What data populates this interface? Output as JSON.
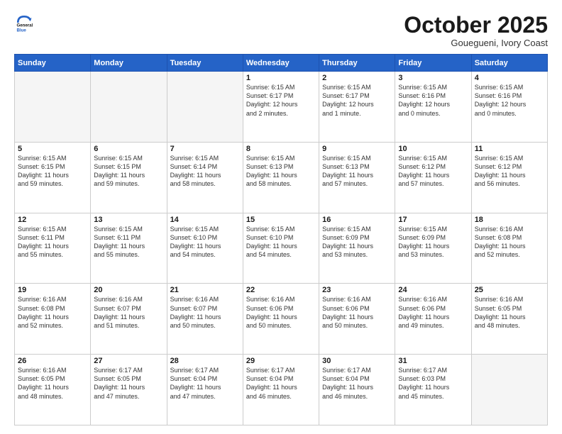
{
  "header": {
    "logo_line1": "General",
    "logo_line2": "Blue",
    "month": "October 2025",
    "location": "Gouegueni, Ivory Coast"
  },
  "weekdays": [
    "Sunday",
    "Monday",
    "Tuesday",
    "Wednesday",
    "Thursday",
    "Friday",
    "Saturday"
  ],
  "weeks": [
    [
      {
        "day": "",
        "info": ""
      },
      {
        "day": "",
        "info": ""
      },
      {
        "day": "",
        "info": ""
      },
      {
        "day": "1",
        "info": "Sunrise: 6:15 AM\nSunset: 6:17 PM\nDaylight: 12 hours\nand 2 minutes."
      },
      {
        "day": "2",
        "info": "Sunrise: 6:15 AM\nSunset: 6:17 PM\nDaylight: 12 hours\nand 1 minute."
      },
      {
        "day": "3",
        "info": "Sunrise: 6:15 AM\nSunset: 6:16 PM\nDaylight: 12 hours\nand 0 minutes."
      },
      {
        "day": "4",
        "info": "Sunrise: 6:15 AM\nSunset: 6:16 PM\nDaylight: 12 hours\nand 0 minutes."
      }
    ],
    [
      {
        "day": "5",
        "info": "Sunrise: 6:15 AM\nSunset: 6:15 PM\nDaylight: 11 hours\nand 59 minutes."
      },
      {
        "day": "6",
        "info": "Sunrise: 6:15 AM\nSunset: 6:15 PM\nDaylight: 11 hours\nand 59 minutes."
      },
      {
        "day": "7",
        "info": "Sunrise: 6:15 AM\nSunset: 6:14 PM\nDaylight: 11 hours\nand 58 minutes."
      },
      {
        "day": "8",
        "info": "Sunrise: 6:15 AM\nSunset: 6:13 PM\nDaylight: 11 hours\nand 58 minutes."
      },
      {
        "day": "9",
        "info": "Sunrise: 6:15 AM\nSunset: 6:13 PM\nDaylight: 11 hours\nand 57 minutes."
      },
      {
        "day": "10",
        "info": "Sunrise: 6:15 AM\nSunset: 6:12 PM\nDaylight: 11 hours\nand 57 minutes."
      },
      {
        "day": "11",
        "info": "Sunrise: 6:15 AM\nSunset: 6:12 PM\nDaylight: 11 hours\nand 56 minutes."
      }
    ],
    [
      {
        "day": "12",
        "info": "Sunrise: 6:15 AM\nSunset: 6:11 PM\nDaylight: 11 hours\nand 55 minutes."
      },
      {
        "day": "13",
        "info": "Sunrise: 6:15 AM\nSunset: 6:11 PM\nDaylight: 11 hours\nand 55 minutes."
      },
      {
        "day": "14",
        "info": "Sunrise: 6:15 AM\nSunset: 6:10 PM\nDaylight: 11 hours\nand 54 minutes."
      },
      {
        "day": "15",
        "info": "Sunrise: 6:15 AM\nSunset: 6:10 PM\nDaylight: 11 hours\nand 54 minutes."
      },
      {
        "day": "16",
        "info": "Sunrise: 6:15 AM\nSunset: 6:09 PM\nDaylight: 11 hours\nand 53 minutes."
      },
      {
        "day": "17",
        "info": "Sunrise: 6:15 AM\nSunset: 6:09 PM\nDaylight: 11 hours\nand 53 minutes."
      },
      {
        "day": "18",
        "info": "Sunrise: 6:16 AM\nSunset: 6:08 PM\nDaylight: 11 hours\nand 52 minutes."
      }
    ],
    [
      {
        "day": "19",
        "info": "Sunrise: 6:16 AM\nSunset: 6:08 PM\nDaylight: 11 hours\nand 52 minutes."
      },
      {
        "day": "20",
        "info": "Sunrise: 6:16 AM\nSunset: 6:07 PM\nDaylight: 11 hours\nand 51 minutes."
      },
      {
        "day": "21",
        "info": "Sunrise: 6:16 AM\nSunset: 6:07 PM\nDaylight: 11 hours\nand 50 minutes."
      },
      {
        "day": "22",
        "info": "Sunrise: 6:16 AM\nSunset: 6:06 PM\nDaylight: 11 hours\nand 50 minutes."
      },
      {
        "day": "23",
        "info": "Sunrise: 6:16 AM\nSunset: 6:06 PM\nDaylight: 11 hours\nand 50 minutes."
      },
      {
        "day": "24",
        "info": "Sunrise: 6:16 AM\nSunset: 6:06 PM\nDaylight: 11 hours\nand 49 minutes."
      },
      {
        "day": "25",
        "info": "Sunrise: 6:16 AM\nSunset: 6:05 PM\nDaylight: 11 hours\nand 48 minutes."
      }
    ],
    [
      {
        "day": "26",
        "info": "Sunrise: 6:16 AM\nSunset: 6:05 PM\nDaylight: 11 hours\nand 48 minutes."
      },
      {
        "day": "27",
        "info": "Sunrise: 6:17 AM\nSunset: 6:05 PM\nDaylight: 11 hours\nand 47 minutes."
      },
      {
        "day": "28",
        "info": "Sunrise: 6:17 AM\nSunset: 6:04 PM\nDaylight: 11 hours\nand 47 minutes."
      },
      {
        "day": "29",
        "info": "Sunrise: 6:17 AM\nSunset: 6:04 PM\nDaylight: 11 hours\nand 46 minutes."
      },
      {
        "day": "30",
        "info": "Sunrise: 6:17 AM\nSunset: 6:04 PM\nDaylight: 11 hours\nand 46 minutes."
      },
      {
        "day": "31",
        "info": "Sunrise: 6:17 AM\nSunset: 6:03 PM\nDaylight: 11 hours\nand 45 minutes."
      },
      {
        "day": "",
        "info": ""
      }
    ]
  ]
}
